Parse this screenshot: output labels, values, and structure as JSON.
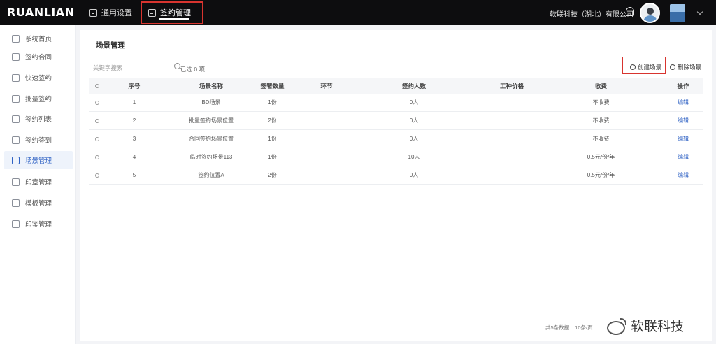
{
  "app": {
    "logo": "RUANLIAN"
  },
  "topnav": {
    "tabs": [
      {
        "label": "通用设置"
      },
      {
        "label": "签约管理"
      }
    ],
    "company": "软联科技（湖北）有限公司"
  },
  "sidebar": {
    "items": [
      {
        "label": "系统首页"
      },
      {
        "label": "签约合同"
      },
      {
        "label": "快速签约"
      },
      {
        "label": "批量签约"
      },
      {
        "label": "签约列表"
      },
      {
        "label": "签约签到"
      },
      {
        "label": "场景管理"
      },
      {
        "label": "印章管理"
      },
      {
        "label": "模板管理"
      },
      {
        "label": "印鉴管理"
      }
    ]
  },
  "main": {
    "title": "场景管理",
    "search_placeholder": "关键字搜索",
    "selected": "已选 0 项",
    "create_label": "创建场景",
    "delete_label": "删除场景",
    "columns": [
      "序号",
      "场景名称",
      "签署数量",
      "环节",
      "签约人数",
      "工种价格",
      "收费",
      "操作"
    ],
    "rows": [
      {
        "no": "1",
        "name": "BD场景",
        "count": "1份",
        "stage": "",
        "people": "0人",
        "price": "",
        "fee": "不收费",
        "action": "编辑"
      },
      {
        "no": "2",
        "name": "批量签约场景位置",
        "count": "2份",
        "stage": "",
        "people": "0人",
        "price": "",
        "fee": "不收费",
        "action": "编辑"
      },
      {
        "no": "3",
        "name": "合同签约场景位置",
        "count": "1份",
        "stage": "",
        "people": "0人",
        "price": "",
        "fee": "不收费",
        "action": "编辑"
      },
      {
        "no": "4",
        "name": "临时签约场景113",
        "count": "1份",
        "stage": "",
        "people": "10人",
        "price": "",
        "fee": "0.5元/份/年",
        "action": "编辑"
      },
      {
        "no": "5",
        "name": "签约位置A",
        "count": "2份",
        "stage": "",
        "people": "0人",
        "price": "",
        "fee": "0.5元/份/年",
        "action": "编辑"
      }
    ],
    "footer": {
      "total": "共5条数据",
      "page_size": "10条/页"
    }
  },
  "watermark": "软联科技",
  "colors": {
    "accent": "#2f62c4",
    "highlight_red": "#d8342f",
    "topbar": "#0d0d0f"
  }
}
